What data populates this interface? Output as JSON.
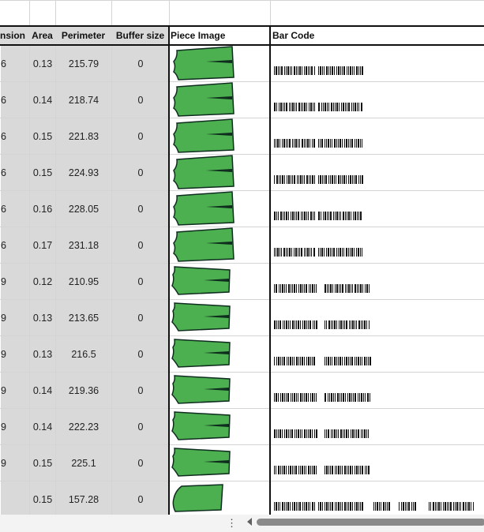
{
  "headers": {
    "dimension": "nsion",
    "area": "Area",
    "perimeter": "Perimeter",
    "buffer": "Buffer size",
    "piece_image": "Piece Image",
    "bar_code": "Bar Code"
  },
  "rows": [
    {
      "dimension": "6",
      "area": "0.13",
      "perimeter": "215.79",
      "buffer": "0",
      "shape": "A",
      "barcode": "A"
    },
    {
      "dimension": "6",
      "area": "0.14",
      "perimeter": "218.74",
      "buffer": "0",
      "shape": "A",
      "barcode": "A"
    },
    {
      "dimension": "6",
      "area": "0.15",
      "perimeter": "221.83",
      "buffer": "0",
      "shape": "A",
      "barcode": "A"
    },
    {
      "dimension": "6",
      "area": "0.15",
      "perimeter": "224.93",
      "buffer": "0",
      "shape": "A",
      "barcode": "A"
    },
    {
      "dimension": "6",
      "area": "0.16",
      "perimeter": "228.05",
      "buffer": "0",
      "shape": "A",
      "barcode": "A"
    },
    {
      "dimension": "6",
      "area": "0.17",
      "perimeter": "231.18",
      "buffer": "0",
      "shape": "A",
      "barcode": "A"
    },
    {
      "dimension": "9",
      "area": "0.12",
      "perimeter": "210.95",
      "buffer": "0",
      "shape": "B",
      "barcode": "B"
    },
    {
      "dimension": "9",
      "area": "0.13",
      "perimeter": "213.65",
      "buffer": "0",
      "shape": "B",
      "barcode": "B"
    },
    {
      "dimension": "9",
      "area": "0.13",
      "perimeter": "216.5",
      "buffer": "0",
      "shape": "B",
      "barcode": "B"
    },
    {
      "dimension": "9",
      "area": "0.14",
      "perimeter": "219.36",
      "buffer": "0",
      "shape": "B",
      "barcode": "B"
    },
    {
      "dimension": "9",
      "area": "0.14",
      "perimeter": "222.23",
      "buffer": "0",
      "shape": "B",
      "barcode": "B"
    },
    {
      "dimension": "9",
      "area": "0.15",
      "perimeter": "225.1",
      "buffer": "0",
      "shape": "B",
      "barcode": "B"
    },
    {
      "dimension": "",
      "area": "0.15",
      "perimeter": "157.28",
      "buffer": "0",
      "shape": "C",
      "barcode": "C"
    }
  ],
  "colors": {
    "piece_fill": "#4caf50",
    "piece_stroke": "#0f2d1f",
    "data_cell_bg": "#d9d9d9",
    "gridline": "#d4d4d4",
    "header_border": "#111111"
  },
  "icons": {
    "scroll_menu": "more-vertical-icon",
    "scroll_left": "scroll-left-arrow-icon"
  }
}
